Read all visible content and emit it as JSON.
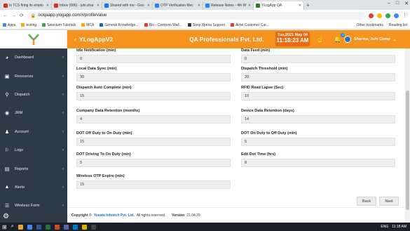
{
  "browser": {
    "tabs": [
      {
        "label": "Is TCS firing its emplo",
        "color": "#c0392b"
      },
      {
        "label": "Inbox (686) - juhi.shar",
        "color": "#d93025"
      },
      {
        "label": "Shared with me - Goo",
        "color": "#1a73e8"
      },
      {
        "label": "OTP Verification Mec",
        "color": "#2684ff"
      },
      {
        "label": "Release Notes - 4th W",
        "color": "#2684ff"
      },
      {
        "label": "YLogApp QA",
        "color": "#2e7d32",
        "active": true
      }
    ],
    "new_tab": "+",
    "url": "ociqaapp.ylogapp.com/#/profileValue",
    "bookmarks": [
      {
        "label": "Apps",
        "color": "#4285f4"
      },
      {
        "label": "testing",
        "color": "#f9ab00"
      },
      {
        "label": "Selenium Tutorials",
        "color": "#43a047"
      },
      {
        "label": "MCA",
        "color": "#f9ab00"
      },
      {
        "label": "General Knowledge...",
        "color": "#1565c0"
      },
      {
        "label": "Rio - Cartoons Wall...",
        "color": "#e53935"
      },
      {
        "label": "Sony Xperia Support",
        "color": "#333333"
      },
      {
        "label": "Airtel Customer Car...",
        "color": "#e53935"
      }
    ],
    "other_bookmarks": "Other bookmarks",
    "reading_list": "Reading list"
  },
  "sidebar": {
    "items": [
      {
        "label": "Dashboard",
        "icon": "dashboard-icon",
        "glyph": "◕"
      },
      {
        "label": "Resources",
        "icon": "resources-icon",
        "glyph": "▣"
      },
      {
        "label": "Dispatch",
        "icon": "dispatch-icon",
        "glyph": "⚲"
      },
      {
        "label": "JRM",
        "icon": "jrm-icon",
        "glyph": "◉"
      },
      {
        "label": "Account",
        "icon": "account-icon",
        "glyph": "♟"
      },
      {
        "label": "Logs",
        "icon": "logs-icon",
        "glyph": "⚐"
      },
      {
        "label": "Reports",
        "icon": "reports-icon",
        "glyph": "▤"
      },
      {
        "label": "Alerts",
        "icon": "alerts-icon",
        "glyph": "▲"
      },
      {
        "label": "Wireless Form",
        "icon": "wireless-form-icon",
        "glyph": "☰"
      }
    ]
  },
  "topbar": {
    "app_title": "YLogAppV2",
    "company": "QA Professionals Pvt. Ltd.",
    "date": "Tue,2021 May 04",
    "time": "11:18:23 AM",
    "notification_count": "0",
    "user_name": "Sharma, Juhi Comp"
  },
  "form": {
    "left": [
      {
        "label": "Idle Notification (min)",
        "value": "0"
      },
      {
        "label": "Local Data Sync (min)",
        "value": "30"
      },
      {
        "label": "Dispatch Auto Complete (min)",
        "value": "15"
      },
      {
        "label": "Company Data Retention (months)",
        "value": "4"
      },
      {
        "label": "DOT Off Duty to On Duty (min)",
        "value": "15"
      },
      {
        "label": "DOT Driving To On Duty (min)",
        "value": "5"
      },
      {
        "label": "Wireless OTP Expire (min)",
        "value": "15"
      }
    ],
    "right": [
      {
        "label": "Data Feed (min)",
        "value": "0"
      },
      {
        "label": "Dispatch Threshold (min)",
        "value": "20"
      },
      {
        "label": "RFID Read Lapse (Sec)",
        "value": "10"
      },
      {
        "label": "Device Data Retention (days)",
        "value": "14"
      },
      {
        "label": "DOT On Duty to Off Duty (min)",
        "value": "5"
      },
      {
        "label": "Edit Dot Time (hrs)",
        "value": "8"
      }
    ]
  },
  "buttons": {
    "back": "Back",
    "next": "Next"
  },
  "footer": {
    "copyright": "Copyright ©",
    "company_link": "Yusata Infotech Pvt. Ltd.",
    "rights": "All rights reserved.",
    "version_label": "Version",
    "version": "21.04.29"
  },
  "taskbar": {
    "lang": "ENG",
    "time": "11:18 AM"
  }
}
